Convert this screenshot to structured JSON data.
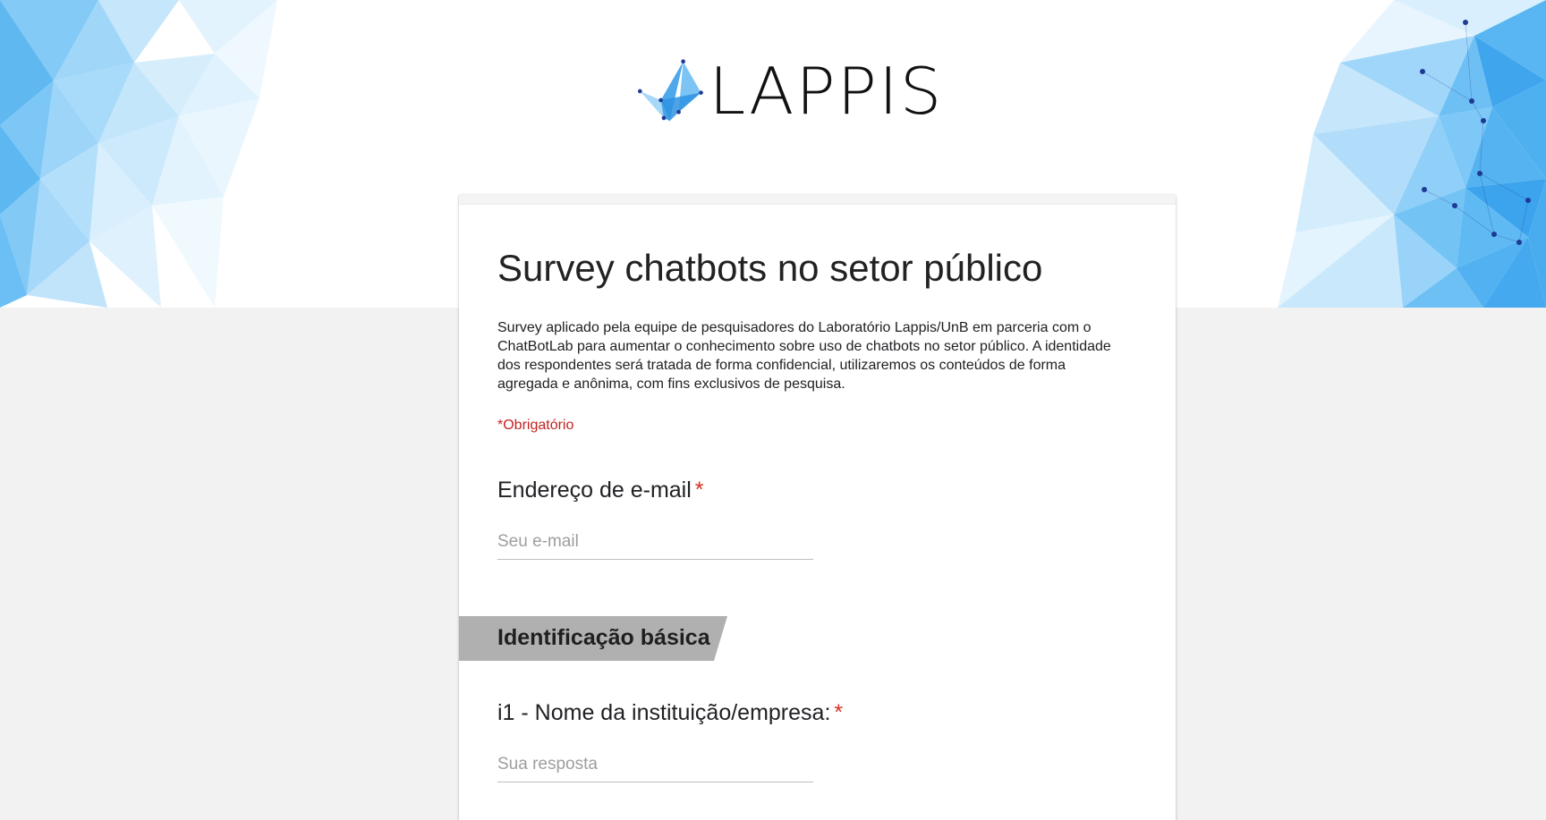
{
  "logo": {
    "text": "LAPPIS",
    "mark_icon": "crown-icon"
  },
  "form": {
    "title": "Survey chatbots no setor público",
    "description": "Survey aplicado pela equipe de pesquisadores do Laboratório Lappis/UnB em parceria com o ChatBotLab para aumentar o conhecimento sobre uso de chatbots no setor público. A identidade dos respondentes será tratada de forma confidencial, utilizaremos os conteúdos de forma agregada e anônima, com fins exclusivos de pesquisa.",
    "required_note": "*Obrigatório"
  },
  "email_question": {
    "label": "Endereço de e-mail",
    "required_mark": "*",
    "placeholder": "Seu e-mail",
    "value": ""
  },
  "section": {
    "title": "Identificação básica"
  },
  "questions": [
    {
      "label": "i1 - Nome da instituição/empresa:",
      "required_mark": "*",
      "placeholder": "Sua resposta",
      "value": ""
    }
  ],
  "colors": {
    "accent_blue": "#42a5f5",
    "required_red": "#d93025",
    "section_gray": "#b0b0b0",
    "page_background": "#f2f2f2"
  }
}
